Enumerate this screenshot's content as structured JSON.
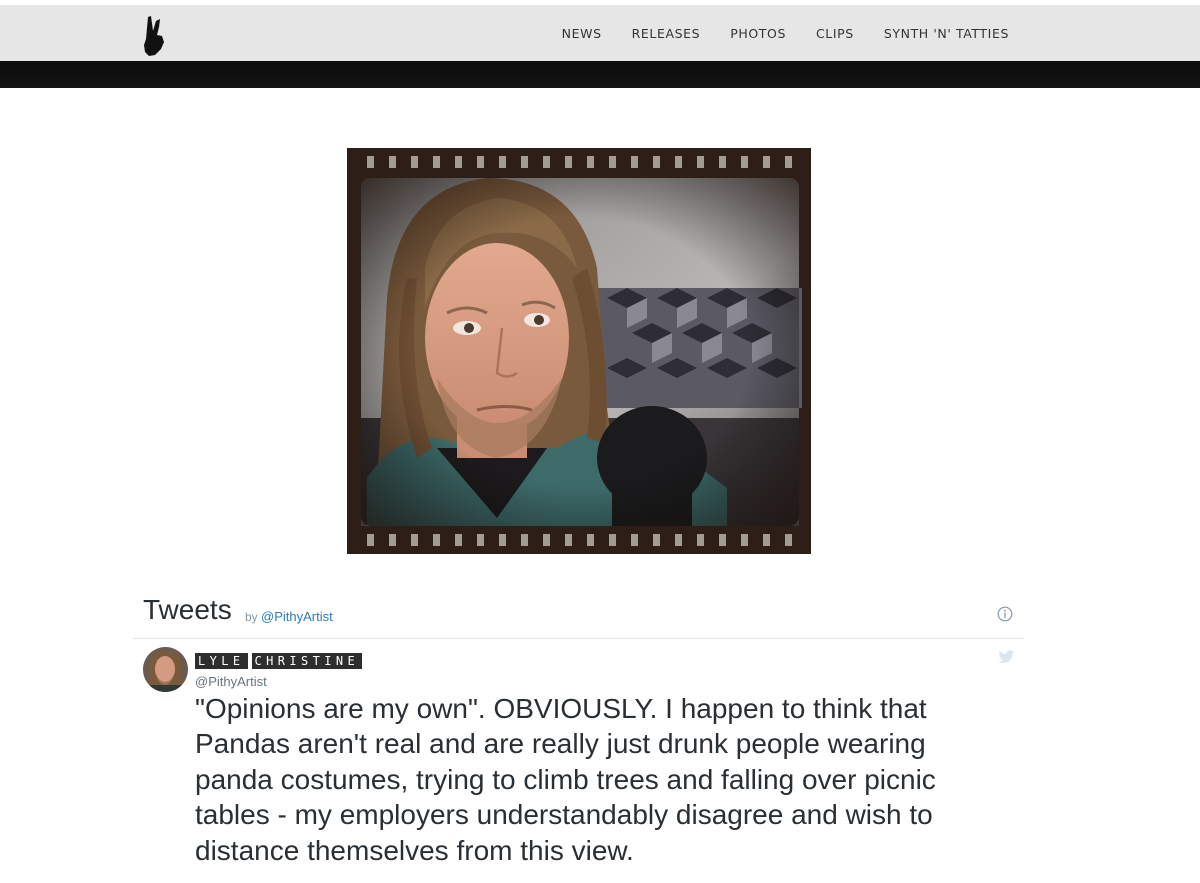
{
  "nav": {
    "logo": "peace-hand-logo",
    "links": [
      "NEWS",
      "RELEASES",
      "PHOTOS",
      "CLIPS",
      "SYNTH 'N' TATTIES"
    ]
  },
  "photo": {
    "alt": "Portrait in film frame"
  },
  "tweets": {
    "title": "Tweets",
    "by_prefix": "by",
    "by_handle": "@PithyArtist",
    "info_icon": "info-icon"
  },
  "tweet": {
    "author_first": "LYLE",
    "author_last": "CHRISTINE",
    "handle": "@PithyArtist",
    "text": "\"Opinions are my own\". OBVIOUSLY. I happen to think that Pandas aren't real and are really just drunk people wearing panda costumes, trying to climb trees and falling over picnic tables - my employers understandably disagree and wish to distance themselves from this view.",
    "source_icon": "twitter-bird-icon"
  },
  "colors": {
    "navbar": "#e6e6e6",
    "band": "#111111",
    "link": "#2b7bb9",
    "text": "#292f33"
  }
}
